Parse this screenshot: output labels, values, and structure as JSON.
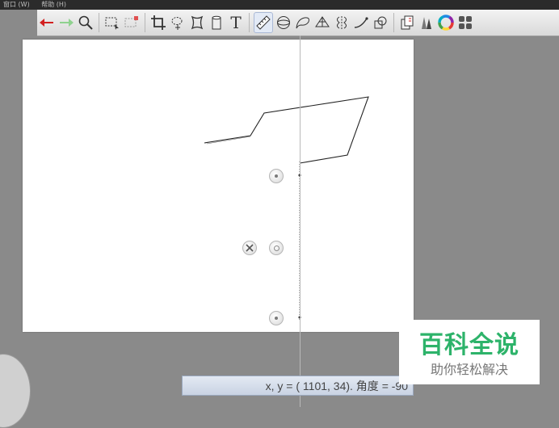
{
  "menubar": {
    "items": [
      "窗口 (W)",
      "帮助 (H)"
    ]
  },
  "toolbar": {
    "buttons": [
      "undo-icon",
      "redo-icon",
      "zoom-icon",
      "selection-icon",
      "transform-selection-icon",
      "crop-icon",
      "lasso-icon",
      "distort-icon",
      "bucket-icon",
      "text-icon",
      "ruler-icon",
      "ellipse-guide-icon",
      "french-curve-icon",
      "perspective-icon",
      "symmetry-icon",
      "stroke-icon",
      "shape-icon",
      "layers-copy-icon",
      "brush-library-icon",
      "color-wheel-icon",
      "panel-grid-icon"
    ],
    "active": "ruler-icon",
    "text_tool_label": "T"
  },
  "status_bar": {
    "text": "x, y = ( 1101,    34). 角度 = -90"
  },
  "watermark": {
    "title": "百科全说",
    "subtitle": "助你轻松解决",
    "color": "#2db36a"
  },
  "colors": {
    "background": "#8a8a8a",
    "canvas": "#ffffff",
    "undo": "#d22020",
    "redo": "#8fd28f"
  }
}
